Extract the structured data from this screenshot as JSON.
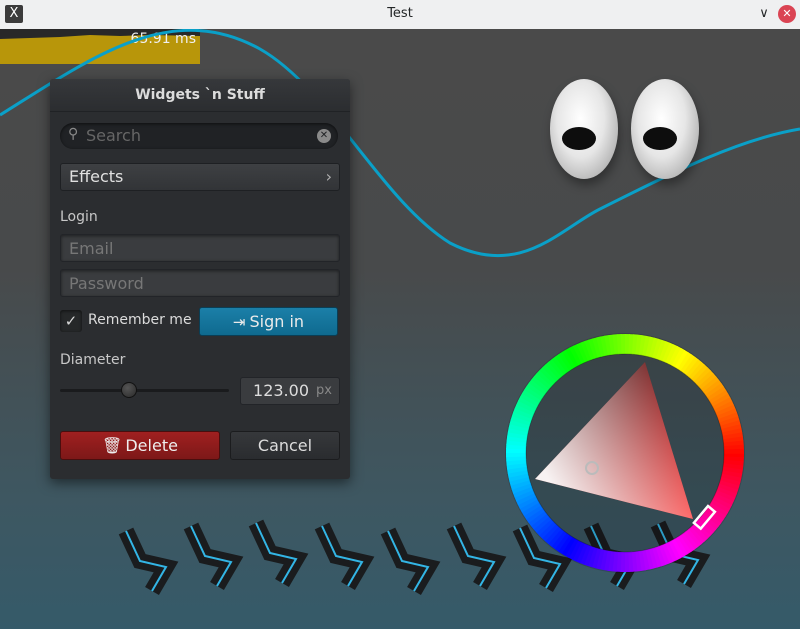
{
  "window": {
    "title": "Test",
    "app_icon": "X",
    "minimize_icon": "∨",
    "close_icon": "✕"
  },
  "perf": {
    "frame_time": "65.91 ms"
  },
  "panel": {
    "title": "Widgets `n Stuff",
    "search": {
      "placeholder": "Search"
    },
    "effects_label": "Effects",
    "login_label": "Login",
    "email": {
      "placeholder": "Email",
      "value": ""
    },
    "password": {
      "placeholder": "Password",
      "value": ""
    },
    "remember": {
      "label": "Remember me",
      "checked": true,
      "mark": "✓"
    },
    "signin_label": "Sign in",
    "diameter_label": "Diameter",
    "diameter": {
      "value": "123.00",
      "unit": "px",
      "slider_fraction": 0.4
    },
    "delete_label": "Delete",
    "cancel_label": "Cancel"
  },
  "icons": {
    "search": "search-icon",
    "clear": "clear-icon",
    "chevron": "chevron-right-icon",
    "signin": "login-icon",
    "trash": "trash-icon"
  },
  "colors": {
    "accent": "#0f6a8f",
    "danger": "#a02020",
    "graph": "#f0c000",
    "curve": "#0aa0c8",
    "chevron_glow": "#33b5e5"
  }
}
